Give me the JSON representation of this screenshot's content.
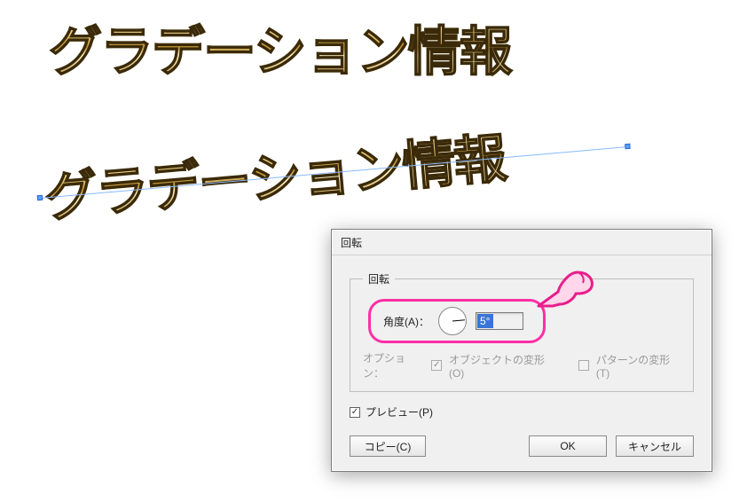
{
  "canvas": {
    "text": "グラデーション情報",
    "rotated_angle_deg": -5
  },
  "dialog": {
    "title": "回転",
    "group_legend": "回転",
    "angle_label": "角度(A)：",
    "angle_value": "5°",
    "options_label": "オプション：",
    "option_transform_object": "オブジェクトの変形(O)",
    "option_transform_object_checked": true,
    "option_transform_pattern": "パターンの変形(T)",
    "option_transform_pattern_checked": false,
    "preview_label": "プレビュー(P)",
    "preview_checked": true,
    "buttons": {
      "copy": "コピー(C)",
      "ok": "OK",
      "cancel": "キャンセル"
    }
  },
  "annotation": {
    "highlight_color": "#ff2ea6"
  }
}
